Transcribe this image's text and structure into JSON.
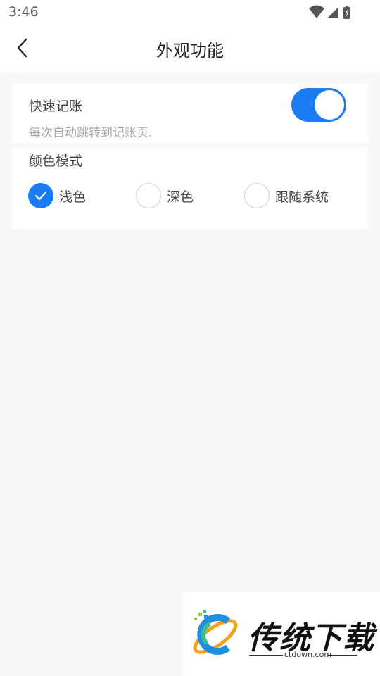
{
  "status_bar": {
    "time": "3:46",
    "icons": [
      "wifi-icon",
      "cell-signal-icon",
      "battery-charging-icon"
    ]
  },
  "header": {
    "title": "外观功能",
    "back_icon": "chevron-left-icon"
  },
  "quick_entry": {
    "title": "快速记账",
    "description": "每次自动跳转到记账页.",
    "enabled": true
  },
  "color_mode": {
    "title": "颜色模式",
    "options": [
      {
        "label": "浅色",
        "selected": true
      },
      {
        "label": "深色",
        "selected": false
      },
      {
        "label": "跟随系统",
        "selected": false
      }
    ]
  },
  "watermark": {
    "brand": "传统下载",
    "domain": "ctdown.com"
  },
  "colors": {
    "accent": "#1a7cf3",
    "background": "#f8f8f9",
    "card": "#ffffff"
  }
}
